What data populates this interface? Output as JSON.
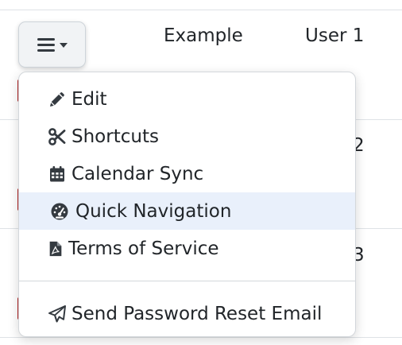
{
  "table": {
    "rows": [
      {
        "name": "Example",
        "user": "User 1"
      },
      {
        "user_suffix": "2"
      },
      {
        "user_suffix": "3"
      }
    ]
  },
  "dropdown": {
    "toggle_icon": "bars-icon",
    "items": [
      {
        "label": "Edit",
        "icon": "pencil-icon"
      },
      {
        "label": "Shortcuts",
        "icon": "scissors-icon"
      },
      {
        "label": "Calendar Sync",
        "icon": "calendar-icon"
      },
      {
        "label": "Quick Navigation",
        "icon": "gauge-icon",
        "active": true
      },
      {
        "label": "Terms of Service",
        "icon": "pdf-file-icon"
      }
    ],
    "footer_items": [
      {
        "label": "Send Password Reset Email",
        "icon": "paper-plane-icon"
      }
    ]
  },
  "colors": {
    "active_item_bg": "#e9f0fb",
    "marker_red": "#b22222",
    "text": "#212529"
  }
}
